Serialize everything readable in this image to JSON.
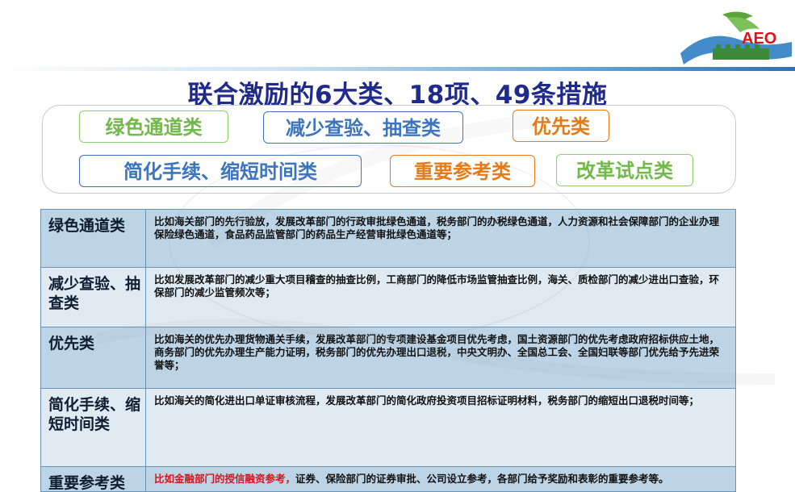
{
  "header": {
    "title": "联合激励的6大类、18项、49条措施",
    "logo_text": "AEO"
  },
  "categories": [
    {
      "label": "绿色通道类"
    },
    {
      "label": "减少查验、抽查类"
    },
    {
      "label": "优先类"
    },
    {
      "label": "简化手续、缩短时间类"
    },
    {
      "label": "重要参考类"
    },
    {
      "label": "改革试点类"
    }
  ],
  "table": {
    "rows": [
      {
        "label": "绿色通道类",
        "text": "比如海关部门的先行验放，发展改革部门的行政审批绿色通道，税务部门的办税绿色通道，人力资源和社会保障部门的企业办理保险绿色通道，食品药品监管部门的药品生产经营审批绿色通道等；"
      },
      {
        "label": "减少查验、抽查类",
        "text": "比如发展改革部门的减少重大项目稽查的抽查比例，工商部门的降低市场监管抽查比例，海关、质检部门的减少进出口查验，环保部门的减少监管频次等；"
      },
      {
        "label": "优先类",
        "text": "比如海关的优先办理货物通关手续，发展改革部门的专项建设基金项目优先考虑，国土资源部门的优先考虑政府招标供应土地，商务部门的优先办理生产能力证明，税务部门的优先办理出口退税，中央文明办、全国总工会、全国妇联等部门优先给予先进荣誉等；"
      },
      {
        "label": "简化手续、缩短时间类",
        "text": "比如海关的简化进出口单证审核流程，发展改革部门的简化政府投资项目招标证明材料，税务部门的缩短出口退税时间等；"
      },
      {
        "label": "重要参考类",
        "highlight": "比如金融部门的授信融资参考，",
        "text": "证券、保险部门的证券审批、公司设立参考，各部门给予奖励和表彰的重要参考等。"
      }
    ]
  }
}
